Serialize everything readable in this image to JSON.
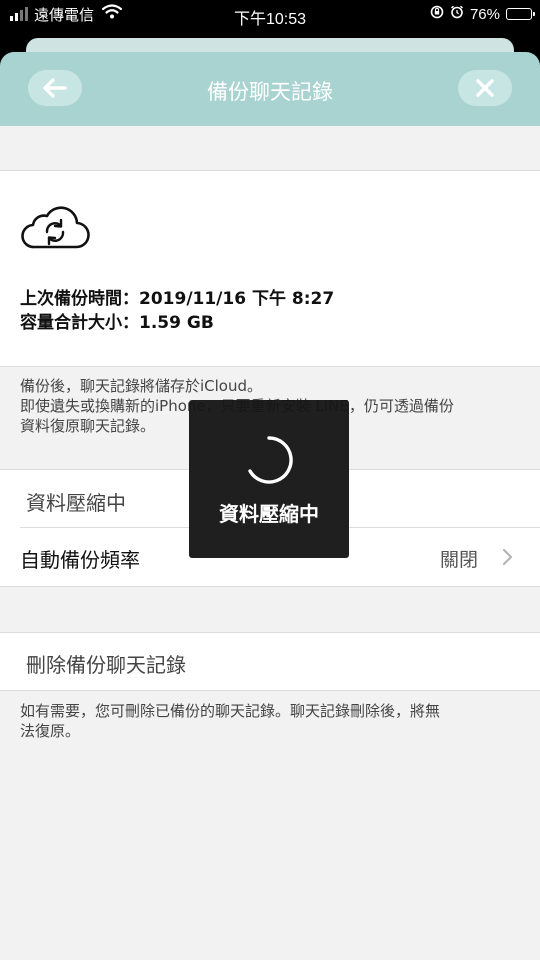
{
  "status_bar": {
    "carrier": "遠傳電信",
    "time": "下午10:53",
    "battery_percent": "76%",
    "battery_level": 0.76,
    "icons": [
      "signal-icon",
      "wifi-icon",
      "rotation-lock-icon",
      "alarm-icon",
      "battery-icon"
    ]
  },
  "header": {
    "title": "備份聊天記錄",
    "back_icon": "arrow-left-icon",
    "close_icon": "close-icon"
  },
  "backup_info": {
    "icon": "cloud-sync-icon",
    "last_backup": "上次備份時間：2019/11/16 下午 8:27",
    "total_size": "容量合計大小：1.59 GB"
  },
  "notes": {
    "backup_note_line1": "備份後，聊天記錄將儲存於iCloud。",
    "backup_note_line2": "即使遺失或換購新的iPhone，只要重新安裝 LINE，仍可透過備份",
    "backup_note_line3": "資料復原聊天記錄。",
    "delete_note_line1": "如有需要，您可刪除已備份的聊天記錄。聊天記錄刪除後，將無",
    "delete_note_line2": "法復原。"
  },
  "settings": {
    "compressing_label": "資料壓縮中",
    "auto_backup_label": "自動備份頻率",
    "auto_backup_value": "關閉",
    "delete_backup_label": "刪除備份聊天記錄"
  },
  "loading_overlay": {
    "text": "資料壓縮中"
  },
  "colors": {
    "header_bg": "#a9d3d1",
    "header_button_bg": "#c7e5e3",
    "page_bg": "#f2f2f2",
    "battery_fill": "#f5c400",
    "hud_bg": "#161616"
  }
}
